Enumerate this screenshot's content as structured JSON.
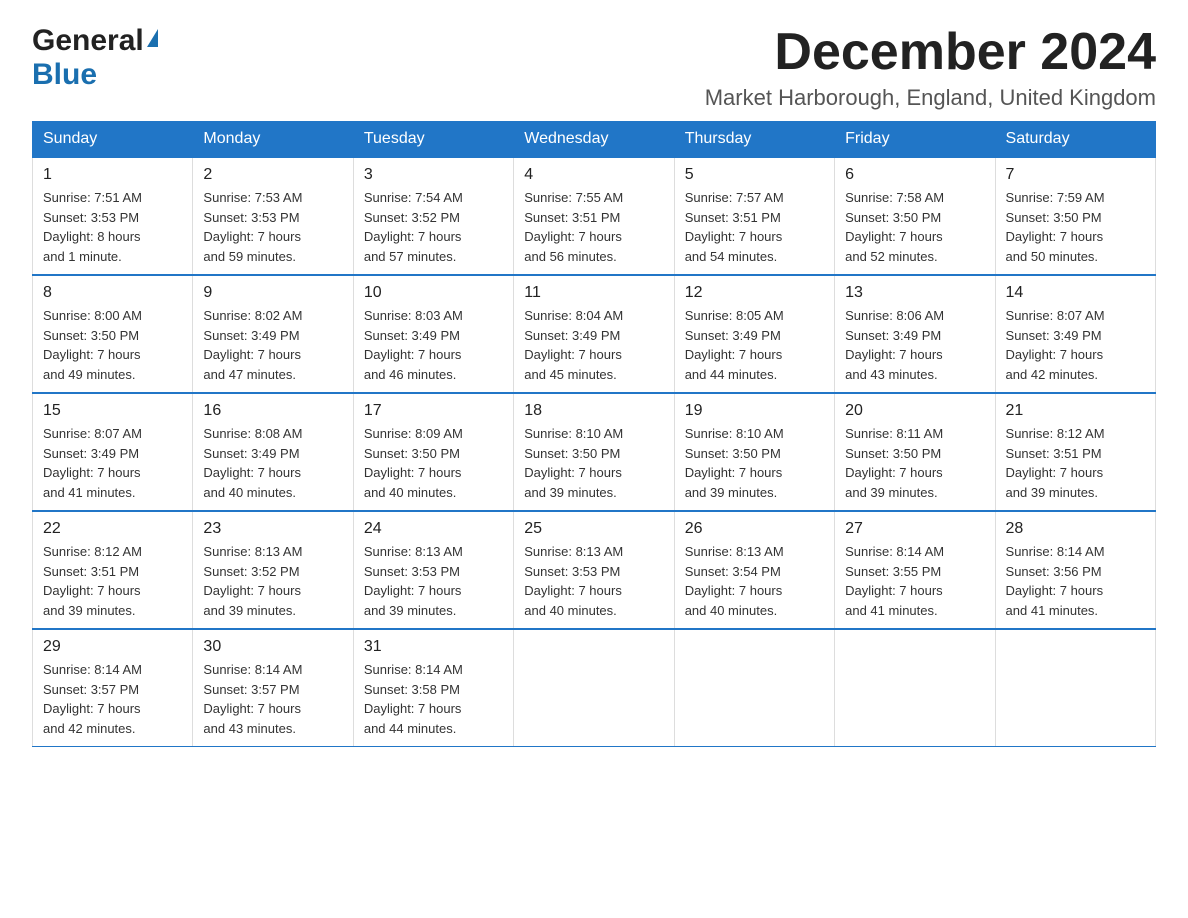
{
  "header": {
    "logo_general": "General",
    "logo_blue": "Blue",
    "month_title": "December 2024",
    "location": "Market Harborough, England, United Kingdom"
  },
  "weekdays": [
    "Sunday",
    "Monday",
    "Tuesday",
    "Wednesday",
    "Thursday",
    "Friday",
    "Saturday"
  ],
  "weeks": [
    [
      {
        "day": "1",
        "sunrise": "7:51 AM",
        "sunset": "3:53 PM",
        "daylight": "8 hours and 1 minute."
      },
      {
        "day": "2",
        "sunrise": "7:53 AM",
        "sunset": "3:53 PM",
        "daylight": "7 hours and 59 minutes."
      },
      {
        "day": "3",
        "sunrise": "7:54 AM",
        "sunset": "3:52 PM",
        "daylight": "7 hours and 57 minutes."
      },
      {
        "day": "4",
        "sunrise": "7:55 AM",
        "sunset": "3:51 PM",
        "daylight": "7 hours and 56 minutes."
      },
      {
        "day": "5",
        "sunrise": "7:57 AM",
        "sunset": "3:51 PM",
        "daylight": "7 hours and 54 minutes."
      },
      {
        "day": "6",
        "sunrise": "7:58 AM",
        "sunset": "3:50 PM",
        "daylight": "7 hours and 52 minutes."
      },
      {
        "day": "7",
        "sunrise": "7:59 AM",
        "sunset": "3:50 PM",
        "daylight": "7 hours and 50 minutes."
      }
    ],
    [
      {
        "day": "8",
        "sunrise": "8:00 AM",
        "sunset": "3:50 PM",
        "daylight": "7 hours and 49 minutes."
      },
      {
        "day": "9",
        "sunrise": "8:02 AM",
        "sunset": "3:49 PM",
        "daylight": "7 hours and 47 minutes."
      },
      {
        "day": "10",
        "sunrise": "8:03 AM",
        "sunset": "3:49 PM",
        "daylight": "7 hours and 46 minutes."
      },
      {
        "day": "11",
        "sunrise": "8:04 AM",
        "sunset": "3:49 PM",
        "daylight": "7 hours and 45 minutes."
      },
      {
        "day": "12",
        "sunrise": "8:05 AM",
        "sunset": "3:49 PM",
        "daylight": "7 hours and 44 minutes."
      },
      {
        "day": "13",
        "sunrise": "8:06 AM",
        "sunset": "3:49 PM",
        "daylight": "7 hours and 43 minutes."
      },
      {
        "day": "14",
        "sunrise": "8:07 AM",
        "sunset": "3:49 PM",
        "daylight": "7 hours and 42 minutes."
      }
    ],
    [
      {
        "day": "15",
        "sunrise": "8:07 AM",
        "sunset": "3:49 PM",
        "daylight": "7 hours and 41 minutes."
      },
      {
        "day": "16",
        "sunrise": "8:08 AM",
        "sunset": "3:49 PM",
        "daylight": "7 hours and 40 minutes."
      },
      {
        "day": "17",
        "sunrise": "8:09 AM",
        "sunset": "3:50 PM",
        "daylight": "7 hours and 40 minutes."
      },
      {
        "day": "18",
        "sunrise": "8:10 AM",
        "sunset": "3:50 PM",
        "daylight": "7 hours and 39 minutes."
      },
      {
        "day": "19",
        "sunrise": "8:10 AM",
        "sunset": "3:50 PM",
        "daylight": "7 hours and 39 minutes."
      },
      {
        "day": "20",
        "sunrise": "8:11 AM",
        "sunset": "3:50 PM",
        "daylight": "7 hours and 39 minutes."
      },
      {
        "day": "21",
        "sunrise": "8:12 AM",
        "sunset": "3:51 PM",
        "daylight": "7 hours and 39 minutes."
      }
    ],
    [
      {
        "day": "22",
        "sunrise": "8:12 AM",
        "sunset": "3:51 PM",
        "daylight": "7 hours and 39 minutes."
      },
      {
        "day": "23",
        "sunrise": "8:13 AM",
        "sunset": "3:52 PM",
        "daylight": "7 hours and 39 minutes."
      },
      {
        "day": "24",
        "sunrise": "8:13 AM",
        "sunset": "3:53 PM",
        "daylight": "7 hours and 39 minutes."
      },
      {
        "day": "25",
        "sunrise": "8:13 AM",
        "sunset": "3:53 PM",
        "daylight": "7 hours and 40 minutes."
      },
      {
        "day": "26",
        "sunrise": "8:13 AM",
        "sunset": "3:54 PM",
        "daylight": "7 hours and 40 minutes."
      },
      {
        "day": "27",
        "sunrise": "8:14 AM",
        "sunset": "3:55 PM",
        "daylight": "7 hours and 41 minutes."
      },
      {
        "day": "28",
        "sunrise": "8:14 AM",
        "sunset": "3:56 PM",
        "daylight": "7 hours and 41 minutes."
      }
    ],
    [
      {
        "day": "29",
        "sunrise": "8:14 AM",
        "sunset": "3:57 PM",
        "daylight": "7 hours and 42 minutes."
      },
      {
        "day": "30",
        "sunrise": "8:14 AM",
        "sunset": "3:57 PM",
        "daylight": "7 hours and 43 minutes."
      },
      {
        "day": "31",
        "sunrise": "8:14 AM",
        "sunset": "3:58 PM",
        "daylight": "7 hours and 44 minutes."
      },
      null,
      null,
      null,
      null
    ]
  ],
  "labels": {
    "sunrise": "Sunrise:",
    "sunset": "Sunset:",
    "daylight": "Daylight:"
  }
}
